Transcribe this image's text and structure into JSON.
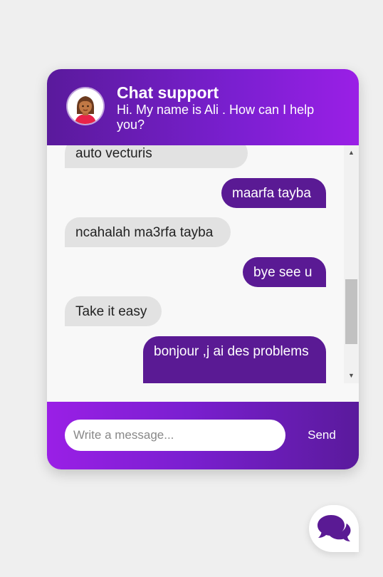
{
  "header": {
    "title": "Chat support",
    "subtitle": "Hi. My name is Ali . How can I help you?",
    "avatar_icon": "agent-avatar-icon"
  },
  "messages": [
    {
      "from": "agent",
      "text": "auto vecturis"
    },
    {
      "from": "user",
      "text": "maarfa tayba"
    },
    {
      "from": "agent",
      "text": "ncahalah ma3rfa tayba"
    },
    {
      "from": "user",
      "text": "bye see u"
    },
    {
      "from": "agent",
      "text": "Take it easy"
    },
    {
      "from": "user",
      "text": "bonjour ,j ai des problems"
    }
  ],
  "composer": {
    "placeholder": "Write a message...",
    "value": "",
    "send_label": "Send"
  },
  "launcher": {
    "icon": "chat-bubbles-icon"
  },
  "colors": {
    "purple_dark": "#5a1a94",
    "purple_bright": "#9a1fe6",
    "bubble_received": "#e2e2e2"
  }
}
